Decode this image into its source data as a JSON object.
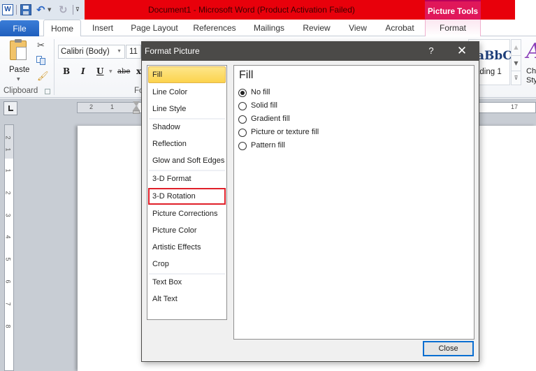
{
  "window": {
    "title": "Document1  -  Microsoft Word (Product Activation Failed)",
    "contextual_tab_group": "Picture Tools",
    "title_bar_color": "#e8000b",
    "contextual_color": "#e0175a"
  },
  "quick_access": {
    "icons": [
      "word-logo-icon",
      "save-icon",
      "undo-icon",
      "redo-icon",
      "customize-qat-icon"
    ]
  },
  "tabs": [
    {
      "label": "File"
    },
    {
      "label": "Home",
      "active": true
    },
    {
      "label": "Insert"
    },
    {
      "label": "Page Layout"
    },
    {
      "label": "References"
    },
    {
      "label": "Mailings"
    },
    {
      "label": "Review"
    },
    {
      "label": "View"
    },
    {
      "label": "Acrobat"
    },
    {
      "label": "Format"
    }
  ],
  "ribbon": {
    "clipboard": {
      "paste_label": "Paste",
      "group_label": "Clipboard"
    },
    "font": {
      "font_name": "Calibri (Body)",
      "font_size": "11",
      "group_label": "Fo",
      "buttons": [
        "B",
        "I",
        "U",
        "abe",
        "x"
      ]
    },
    "styles": {
      "sample": "aBbC",
      "style_name": "ading 1",
      "change_styles_glyph": "A",
      "change_styles_label_1": "Ch",
      "change_styles_label_2": "Sty"
    }
  },
  "ruler": {
    "horizontal_labels": [
      "2",
      "1",
      "17"
    ],
    "vertical_labels": [
      "2",
      "1",
      "1",
      "2",
      "3",
      "4",
      "5",
      "6",
      "7",
      "8"
    ]
  },
  "dialog": {
    "title": "Format Picture",
    "help_glyph": "?",
    "close_glyph": "✕",
    "nav": [
      {
        "label": "Fill",
        "selected": true
      },
      {
        "label": "Line Color"
      },
      {
        "label": "Line Style"
      },
      {
        "label": "Shadow"
      },
      {
        "label": "Reflection"
      },
      {
        "label": "Glow and Soft Edges"
      },
      {
        "label": "3-D Format"
      },
      {
        "label": "3-D Rotation",
        "highlighted": true
      },
      {
        "label": "Picture Corrections"
      },
      {
        "label": "Picture Color"
      },
      {
        "label": "Artistic Effects"
      },
      {
        "label": "Crop"
      },
      {
        "label": "Text Box"
      },
      {
        "label": "Alt Text"
      }
    ],
    "content": {
      "heading": "Fill",
      "options": [
        {
          "label": "No fill",
          "checked": true
        },
        {
          "label": "Solid fill",
          "checked": false
        },
        {
          "label": "Gradient fill",
          "checked": false
        },
        {
          "label": "Picture or texture fill",
          "checked": false
        },
        {
          "label": "Pattern fill",
          "checked": false
        }
      ]
    },
    "close_button": "Close"
  }
}
